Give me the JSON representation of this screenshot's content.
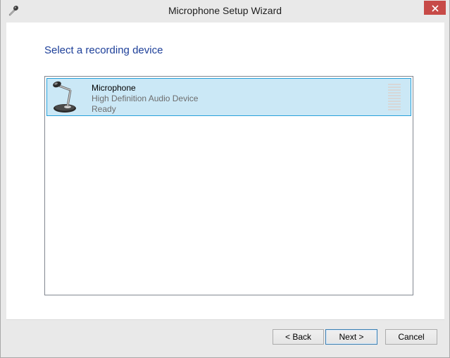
{
  "window": {
    "title": "Microphone Setup Wizard",
    "app_icon": "microphone-icon",
    "close_icon": "close-icon",
    "accent_close": "#c74a47"
  },
  "page": {
    "heading": "Select a recording device"
  },
  "devices": [
    {
      "name": "Microphone",
      "description": "High Definition Audio Device",
      "status": "Ready",
      "icon": "desk-microphone-icon",
      "selected": true,
      "level": 0
    }
  ],
  "buttons": {
    "back": "< Back",
    "next": "Next >",
    "cancel": "Cancel"
  },
  "colors": {
    "heading": "#1d3f99",
    "selection_bg": "#cbe8f6",
    "selection_border": "#26a0da"
  }
}
